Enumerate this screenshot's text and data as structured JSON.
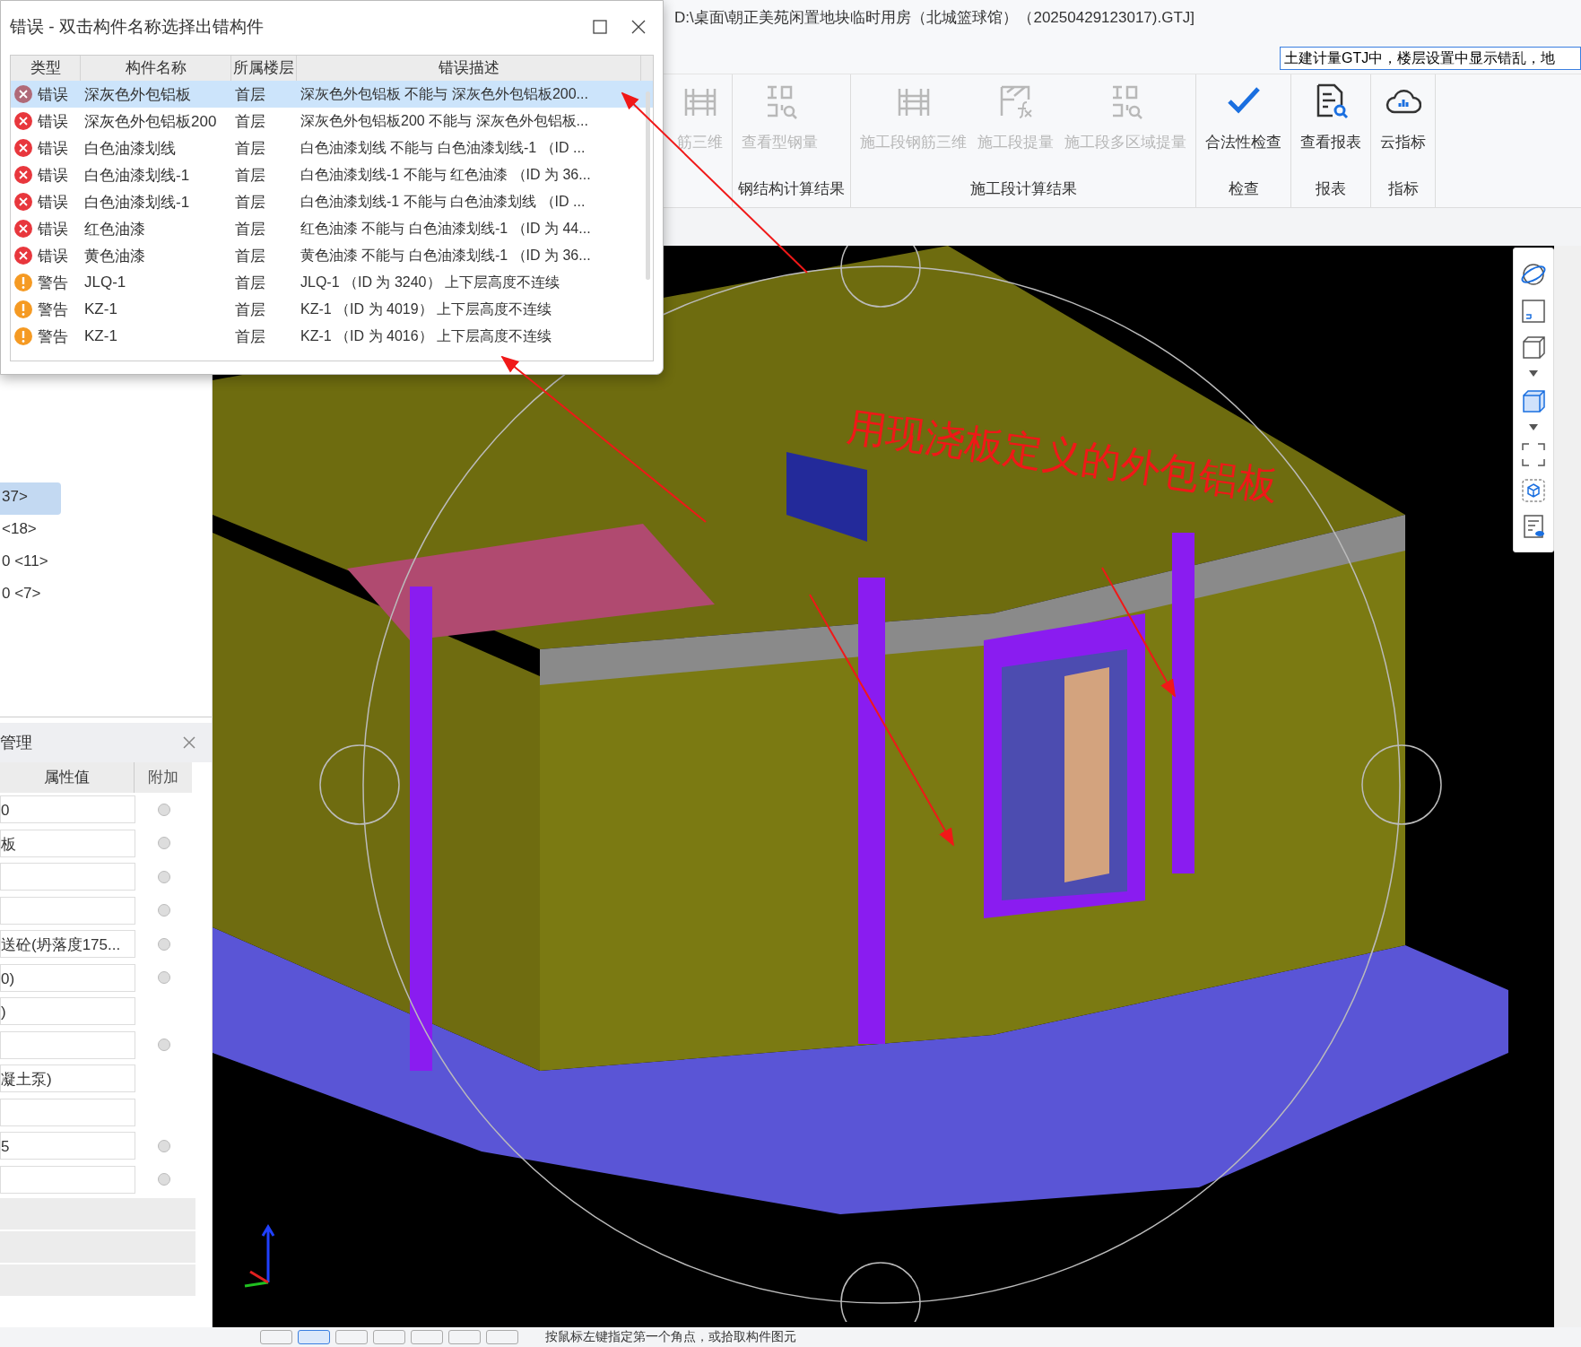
{
  "title_bar": {
    "file_path": "D:\\桌面\\朝正美苑闲置地块临时用房（北城篮球馆）（20250429123017).GTJ]"
  },
  "search": {
    "value": "土建计量GTJ中，楼层设置中显示错乱，地"
  },
  "ribbon": {
    "groups": [
      {
        "buttons": [
          {
            "label": "筋三维",
            "kind": "rebar3d",
            "disabled": true
          }
        ]
      },
      {
        "label": "钢结构计算结果",
        "buttons": [
          {
            "label": "查看型钢量",
            "kind": "steel",
            "disabled": true
          }
        ]
      },
      {
        "label": "施工段计算结果",
        "buttons": [
          {
            "label": "施工段钢筋三维",
            "kind": "rebar3d",
            "disabled": true
          },
          {
            "label": "施工段提量",
            "kind": "formula",
            "disabled": true
          },
          {
            "label": "施工段多区域提量",
            "kind": "steel",
            "disabled": true
          }
        ]
      },
      {
        "label": "检查",
        "buttons": [
          {
            "label": "合法性检查",
            "kind": "check",
            "disabled": false
          }
        ]
      },
      {
        "label": "报表",
        "buttons": [
          {
            "label": "查看报表",
            "kind": "report",
            "disabled": false
          }
        ]
      },
      {
        "label": "指标",
        "buttons": [
          {
            "label": "云指标",
            "kind": "cloud",
            "disabled": false
          }
        ]
      }
    ]
  },
  "left_panel": {
    "tree_items": [
      {
        "label": "37>",
        "selected": true
      },
      {
        "label": "<18>",
        "selected": false
      },
      {
        "label": "0 <11>",
        "selected": false
      },
      {
        "label": "0 <7>",
        "selected": false
      }
    ],
    "properties": {
      "title": "管理",
      "columns": [
        "属性值",
        "附加"
      ],
      "rows": [
        {
          "value": "0",
          "has_checkbox": true
        },
        {
          "value": "板",
          "has_checkbox": true
        },
        {
          "has_checkbox": true
        },
        {
          "has_checkbox": true
        },
        {
          "value": "送砼(坍落度175...",
          "has_checkbox": true
        },
        {
          "value": "0)",
          "has_checkbox": true
        },
        {
          "value": ")",
          "has_checkbox": false
        },
        {
          "has_checkbox": true
        },
        {
          "value": "凝土泵)",
          "has_checkbox": false
        },
        {
          "has_checkbox": false
        },
        {
          "value": "5",
          "has_checkbox": true
        },
        {
          "has_checkbox": true
        }
      ]
    }
  },
  "viewport": {
    "annotation": "用现浇板定义的外包铝板"
  },
  "status_bar": {
    "hint": "按鼠标左键指定第一个角点，或拾取构件图元"
  },
  "dialog": {
    "title": "错误 - 双击构件名称选择出错构件",
    "columns": [
      "类型",
      "构件名称",
      "所属楼层",
      "错误描述"
    ],
    "rows": [
      {
        "kind": "error",
        "type": "错误",
        "name": "深灰色外包铝板",
        "floor": "首层",
        "description": "深灰色外包铝板 不能与 深灰色外包铝板200...",
        "selected": true
      },
      {
        "kind": "error",
        "type": "错误",
        "name": "深灰色外包铝板200",
        "floor": "首层",
        "description": "深灰色外包铝板200 不能与 深灰色外包铝板...",
        "selected": false
      },
      {
        "kind": "error",
        "type": "错误",
        "name": "白色油漆划线",
        "floor": "首层",
        "description": "白色油漆划线 不能与 白色油漆划线-1 （ID ...",
        "selected": false
      },
      {
        "kind": "error",
        "type": "错误",
        "name": "白色油漆划线-1",
        "floor": "首层",
        "description": "白色油漆划线-1 不能与 红色油漆 （ID 为 36...",
        "selected": false
      },
      {
        "kind": "error",
        "type": "错误",
        "name": "白色油漆划线-1",
        "floor": "首层",
        "description": "白色油漆划线-1 不能与 白色油漆划线 （ID ...",
        "selected": false
      },
      {
        "kind": "error",
        "type": "错误",
        "name": "红色油漆",
        "floor": "首层",
        "description": "红色油漆 不能与 白色油漆划线-1 （ID 为 44...",
        "selected": false
      },
      {
        "kind": "error",
        "type": "错误",
        "name": "黄色油漆",
        "floor": "首层",
        "description": "黄色油漆 不能与 白色油漆划线-1 （ID 为 36...",
        "selected": false
      },
      {
        "kind": "warning",
        "type": "警告",
        "name": "JLQ-1",
        "floor": "首层",
        "description": "JLQ-1 （ID 为 3240） 上下层高度不连续",
        "selected": false
      },
      {
        "kind": "warning",
        "type": "警告",
        "name": "KZ-1",
        "floor": "首层",
        "description": "KZ-1 （ID 为 4019） 上下层高度不连续",
        "selected": false
      },
      {
        "kind": "warning",
        "type": "警告",
        "name": "KZ-1",
        "floor": "首层",
        "description": "KZ-1 （ID 为 4016） 上下层高度不连续",
        "selected": false
      }
    ]
  }
}
